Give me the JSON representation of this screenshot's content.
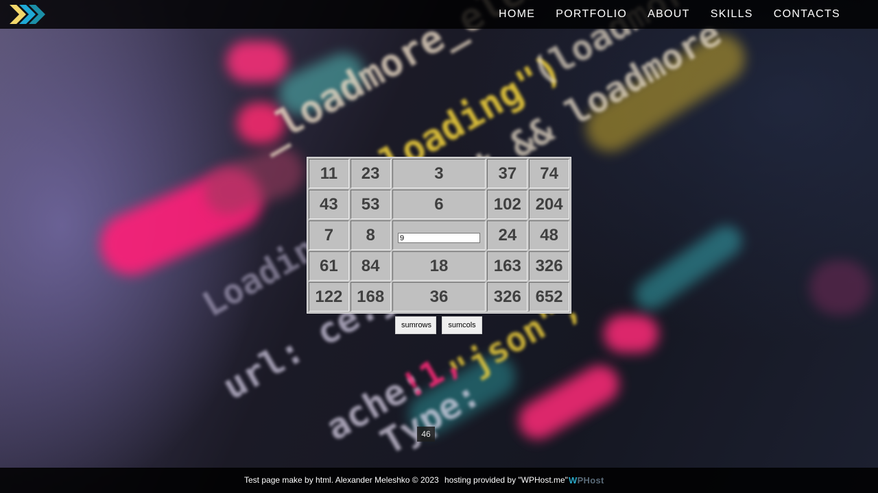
{
  "nav": {
    "logo_icon": "chevrons-logo-icon",
    "items": [
      {
        "label": "HOME"
      },
      {
        "label": "PORTFOLIO"
      },
      {
        "label": "ABOUT"
      },
      {
        "label": "SKILLS"
      },
      {
        "label": "CONTACTS"
      }
    ]
  },
  "table": {
    "rows": [
      [
        "11",
        "23",
        "3",
        "37",
        "74"
      ],
      [
        "43",
        "53",
        "6",
        "102",
        "204"
      ],
      [
        "7",
        "8",
        "",
        "24",
        "48"
      ],
      [
        "61",
        "84",
        "18",
        "163",
        "326"
      ],
      [
        "122",
        "168",
        "36",
        "326",
        "652"
      ]
    ],
    "input_value": "9"
  },
  "buttons": {
    "sumrows": "sumrows",
    "sumcols": "sumcols"
  },
  "result": "46",
  "footer": {
    "copyright": "Test page make by html. Alexander Meleshko © 2023",
    "hosting": "hosting provided by \"WPHost.me\"",
    "host_logo_w": "W",
    "host_logo_rest": "PHost"
  },
  "colors": {
    "logo_yellow": "#f2d76b",
    "logo_blue": "#1fa9d6",
    "logo_teal": "#1b8fa8"
  }
}
